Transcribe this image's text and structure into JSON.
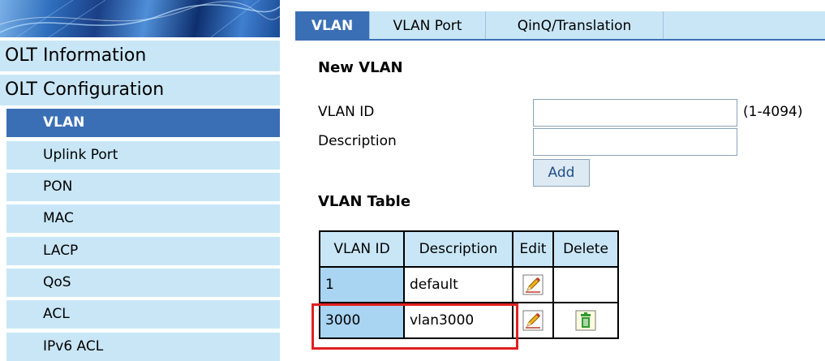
{
  "sidebar": {
    "groups": [
      {
        "label": "OLT Information"
      },
      {
        "label": "OLT Configuration"
      }
    ],
    "items": [
      {
        "label": "VLAN",
        "active": true
      },
      {
        "label": "Uplink Port"
      },
      {
        "label": "PON"
      },
      {
        "label": "MAC"
      },
      {
        "label": "LACP"
      },
      {
        "label": "QoS"
      },
      {
        "label": "ACL"
      },
      {
        "label": "IPv6 ACL"
      }
    ]
  },
  "tabs": [
    {
      "label": "VLAN",
      "active": true
    },
    {
      "label": "VLAN Port"
    },
    {
      "label": "QinQ/Translation"
    }
  ],
  "new_vlan": {
    "title": "New VLAN",
    "vlan_id_label": "VLAN ID",
    "vlan_id_value": "",
    "vlan_id_hint": "(1-4094)",
    "description_label": "Description",
    "description_value": "",
    "add_label": "Add"
  },
  "vlan_table": {
    "title": "VLAN Table",
    "headers": [
      "VLAN ID",
      "Description",
      "Edit",
      "Delete"
    ],
    "rows": [
      {
        "id": "1",
        "description": "default",
        "editable": true,
        "deletable": false
      },
      {
        "id": "3000",
        "description": "vlan3000",
        "editable": true,
        "deletable": true,
        "highlighted": true
      }
    ]
  },
  "icons": {
    "edit": "pencil-edit-icon",
    "delete": "trash-delete-icon"
  },
  "colors": {
    "menu_bg": "#c9e6f6",
    "active_bg": "#3a6fb5",
    "highlight": "#e02020",
    "id_cell_bg": "#a9d4f2"
  }
}
